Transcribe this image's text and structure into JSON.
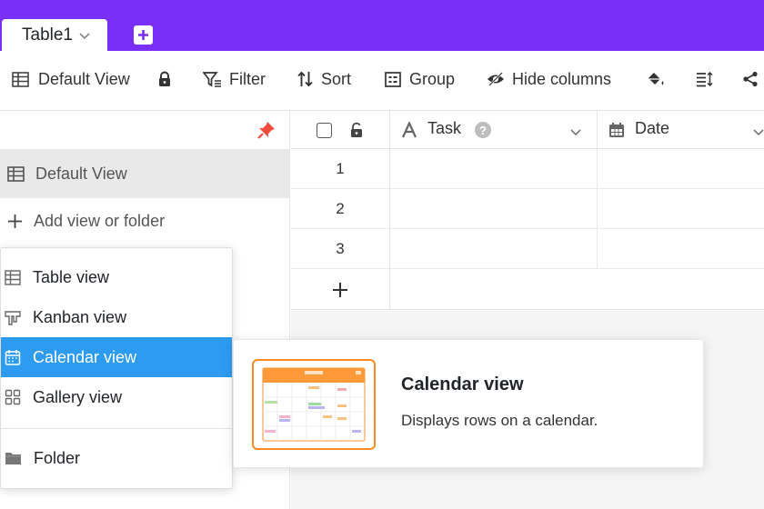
{
  "colors": {
    "brand": "#7a2ff7",
    "accent": "#2d9bf0",
    "preview_border": "#ff8a1f",
    "pin": "#f04b3c"
  },
  "tabs": {
    "active_table": "Table1",
    "add_icon": "plus-square-icon"
  },
  "toolbar": {
    "current_view": "Default View",
    "filter_label": "Filter",
    "sort_label": "Sort",
    "group_label": "Group",
    "hide_columns_label": "Hide columns",
    "icons": [
      "table-icon",
      "lock-icon",
      "filter-icon",
      "sort-icon",
      "group-icon",
      "hide-columns-icon",
      "paint-bucket-icon",
      "row-height-icon",
      "share-icon"
    ]
  },
  "sidebar": {
    "views": [
      {
        "label": "Default View",
        "selected": true
      }
    ],
    "add_view_label": "Add view or folder"
  },
  "view_menu": {
    "items": [
      {
        "label": "Table view",
        "icon": "table-icon"
      },
      {
        "label": "Kanban view",
        "icon": "kanban-icon"
      },
      {
        "label": "Calendar view",
        "icon": "calendar-icon",
        "highlighted": true
      },
      {
        "label": "Gallery view",
        "icon": "gallery-icon"
      }
    ],
    "folder_label": "Folder"
  },
  "preview": {
    "title": "Calendar view",
    "description": "Displays rows on a calendar."
  },
  "grid": {
    "columns": [
      {
        "label": "Task",
        "type_icon": "text-type-icon",
        "has_help": true
      },
      {
        "label": "Date",
        "type_icon": "calendar-icon"
      }
    ],
    "rows": [
      "1",
      "2",
      "3"
    ]
  }
}
